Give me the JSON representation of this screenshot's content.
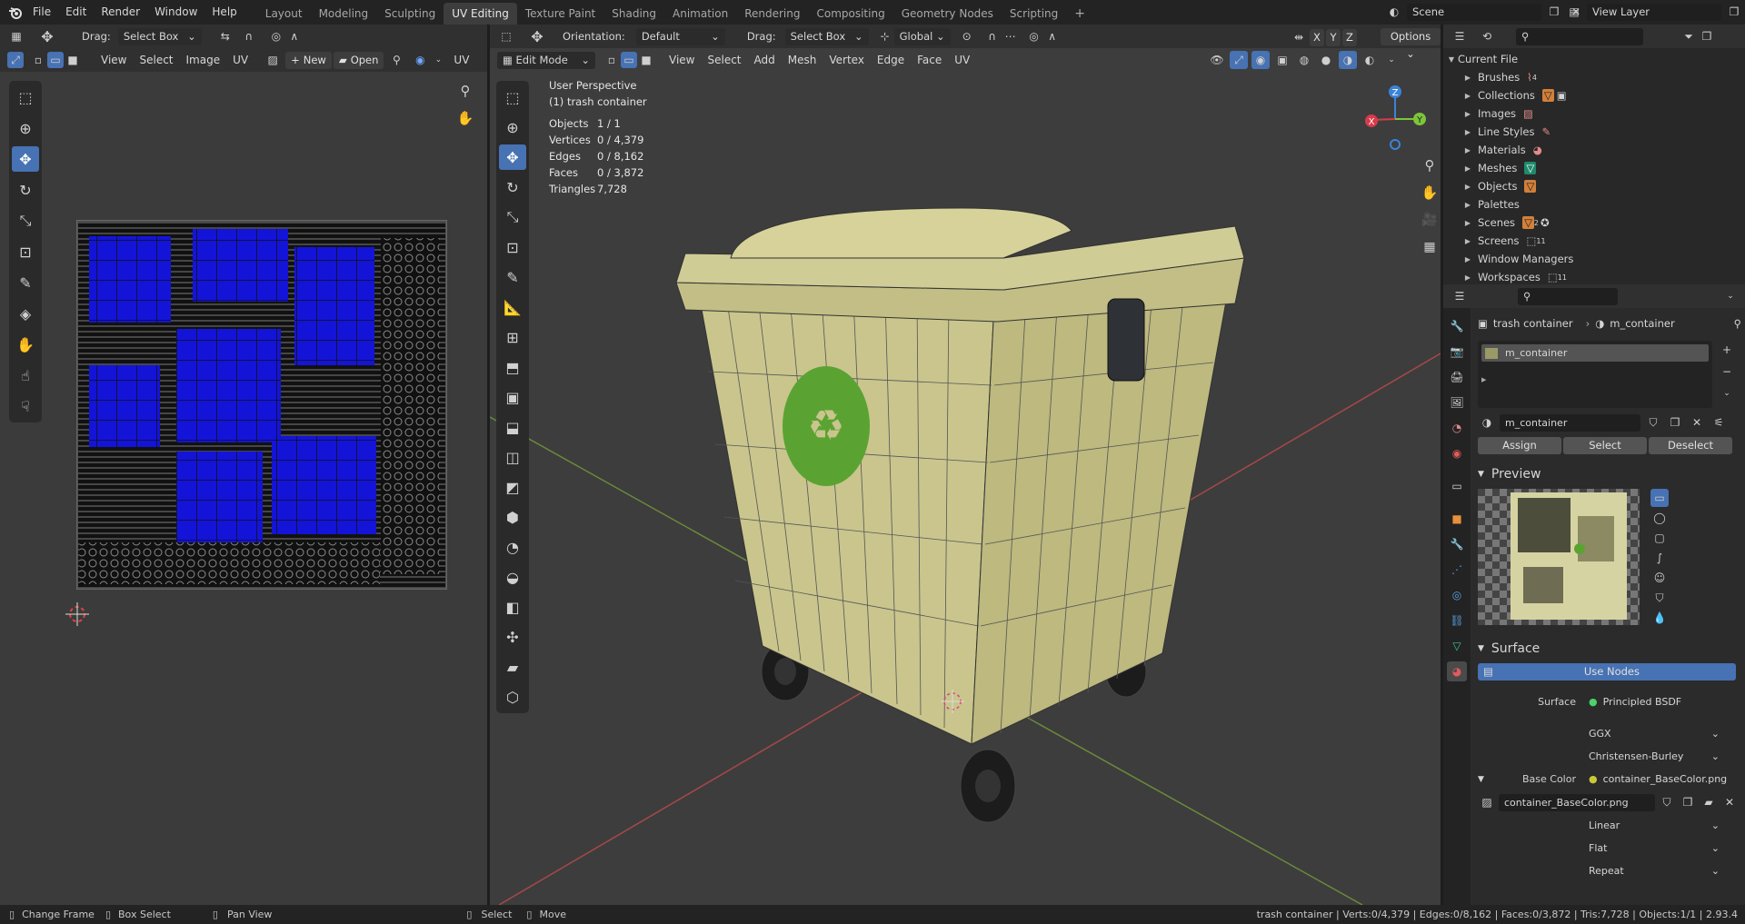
{
  "app": {
    "menus": [
      "File",
      "Edit",
      "Render",
      "Window",
      "Help"
    ],
    "workspaces": [
      "Layout",
      "Modeling",
      "Sculpting",
      "UV Editing",
      "Texture Paint",
      "Shading",
      "Animation",
      "Rendering",
      "Compositing",
      "Geometry Nodes",
      "Scripting"
    ],
    "active_workspace": "UV Editing",
    "scene": "Scene",
    "view_layer": "View Layer"
  },
  "uv_editor": {
    "drag_label": "Drag:",
    "drag_value": "Select Box",
    "menus": [
      "View",
      "Select",
      "Image",
      "UV"
    ],
    "new_label": "New",
    "open_label": "Open",
    "uv_label": "UV"
  },
  "viewport": {
    "mode": "Edit Mode",
    "orientation_label": "Orientation:",
    "orientation_value": "Default",
    "drag_label": "Drag:",
    "drag_value": "Select Box",
    "transform_value": "Global",
    "options_label": "Options",
    "menus": [
      "View",
      "Select",
      "Add",
      "Mesh",
      "Vertex",
      "Edge",
      "Face",
      "UV"
    ],
    "view_name": "User Perspective",
    "object_name": "(1) trash container",
    "stats": [
      {
        "label": "Objects",
        "value": "1 / 1"
      },
      {
        "label": "Vertices",
        "value": "0 / 4,379"
      },
      {
        "label": "Edges",
        "value": "0 / 8,162"
      },
      {
        "label": "Faces",
        "value": "0 / 3,872"
      },
      {
        "label": "Triangles",
        "value": "7,728"
      }
    ],
    "gizmo": {
      "x": "X",
      "y": "Y",
      "z": "Z"
    },
    "xyz_buttons": [
      "X",
      "Y",
      "Z"
    ]
  },
  "outliner": {
    "root": "Current File",
    "items": [
      {
        "label": "Brushes",
        "badge": "4"
      },
      {
        "label": "Collections",
        "badge": ""
      },
      {
        "label": "Images",
        "badge": ""
      },
      {
        "label": "Line Styles",
        "badge": ""
      },
      {
        "label": "Materials",
        "badge": ""
      },
      {
        "label": "Meshes",
        "badge": ""
      },
      {
        "label": "Objects",
        "badge": ""
      },
      {
        "label": "Palettes",
        "badge": ""
      },
      {
        "label": "Scenes",
        "badge": "2"
      },
      {
        "label": "Screens",
        "badge": "11"
      },
      {
        "label": "Window Managers",
        "badge": ""
      },
      {
        "label": "Workspaces",
        "badge": "11"
      }
    ]
  },
  "properties": {
    "object_name": "trash container",
    "material_name": "m_container",
    "slot_name": "m_container",
    "assign": "Assign",
    "select": "Select",
    "deselect": "Deselect",
    "preview_title": "Preview",
    "surface_title": "Surface",
    "use_nodes": "Use Nodes",
    "surface_label": "Surface",
    "surface_value": "Principled BSDF",
    "distribution": "GGX",
    "subsurface": "Christensen-Burley",
    "base_color_label": "Base Color",
    "base_color_value": "container_BaseColor.png",
    "image_name": "container_BaseColor.png",
    "interpolation": "Linear",
    "projection": "Flat",
    "extension": "Repeat"
  },
  "statusbar": {
    "items": [
      "Change Frame",
      "Box Select",
      "Pan View",
      "Select",
      "Move"
    ],
    "stats": "trash container | Verts:0/4,379 | Edges:0/8,162 | Faces:0/3,872 | Tris:7,728 | Objects:1/1 | 2.93.4"
  },
  "colors": {
    "accent": "#4772b3",
    "uv_blue": "#1414d8",
    "bin_color": "#c8c78e",
    "logo_green": "#5aa332"
  }
}
